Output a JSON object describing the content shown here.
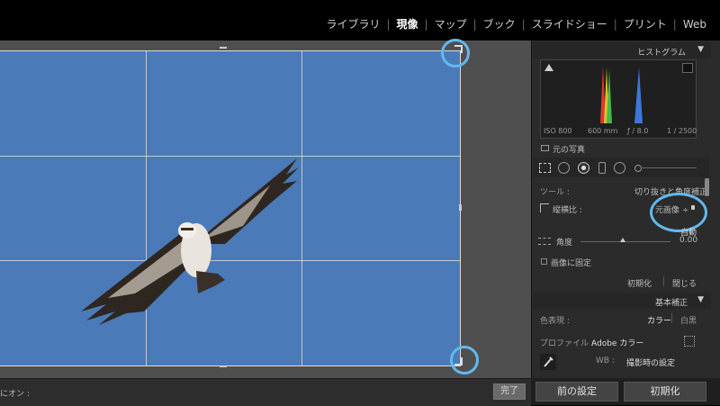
{
  "modules": [
    "ライブラリ",
    "現像",
    "マップ",
    "ブック",
    "スライドショー",
    "プリント",
    "Web"
  ],
  "active_module": "現像",
  "histogram": {
    "title": "ヒストグラム",
    "iso": "ISO 800",
    "focal": "600 mm",
    "aperture": "ƒ / 8.0",
    "shutter": "1 / 2500",
    "original_photo": "元の写真"
  },
  "crop": {
    "tool_label": "ツール :",
    "tool_value": "切り抜きと角度補正",
    "aspect_label": "縦横比 :",
    "aspect_value": "元画像 ÷",
    "auto_label": "自動",
    "angle_label": "角度",
    "angle_value": "0.00",
    "constrain_label": "画像に固定",
    "reset_label": "初期化",
    "close_label": "閉じる"
  },
  "basic": {
    "title": "基本補正",
    "treatment_label": "色表現 :",
    "treatment_color": "カラー",
    "treatment_bw": "白黒",
    "profile_label": "プロファイル :",
    "profile_value": "Adobe カラー",
    "wb_label": "WB :",
    "wb_value": "撮影時の設定"
  },
  "toolbar": {
    "left_label": "にオン :",
    "done_label": "完了"
  },
  "panel_buttons": {
    "previous": "前の設定",
    "reset": "初期化"
  },
  "colors": {
    "sky": "#4a7ab8",
    "annotation": "#62b9ef",
    "panel_bg": "#2b2b2b"
  }
}
